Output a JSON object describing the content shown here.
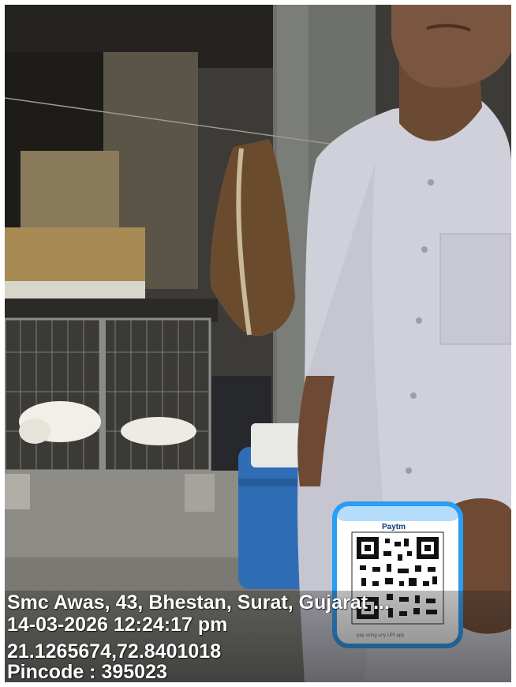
{
  "photo": {
    "description_icon": "photo-icon",
    "payment_stand_brand": "Paytm",
    "payment_stand_footer": "pay using any UPI app"
  },
  "caption": {
    "address": "Smc Awas, 43, Bhestan, Surat, Gujarat ...",
    "datetime": "14-03-2026 12:24:17 pm",
    "coordinates": "21.1265674,72.8401018",
    "pincode": "Pincode : 395023"
  },
  "colors": {
    "border": "#ffffff",
    "shirt": "#cfd0d9",
    "drum": "#2f6eb5",
    "stand_accent": "#2a9df4",
    "caption_text": "#ffffff"
  }
}
